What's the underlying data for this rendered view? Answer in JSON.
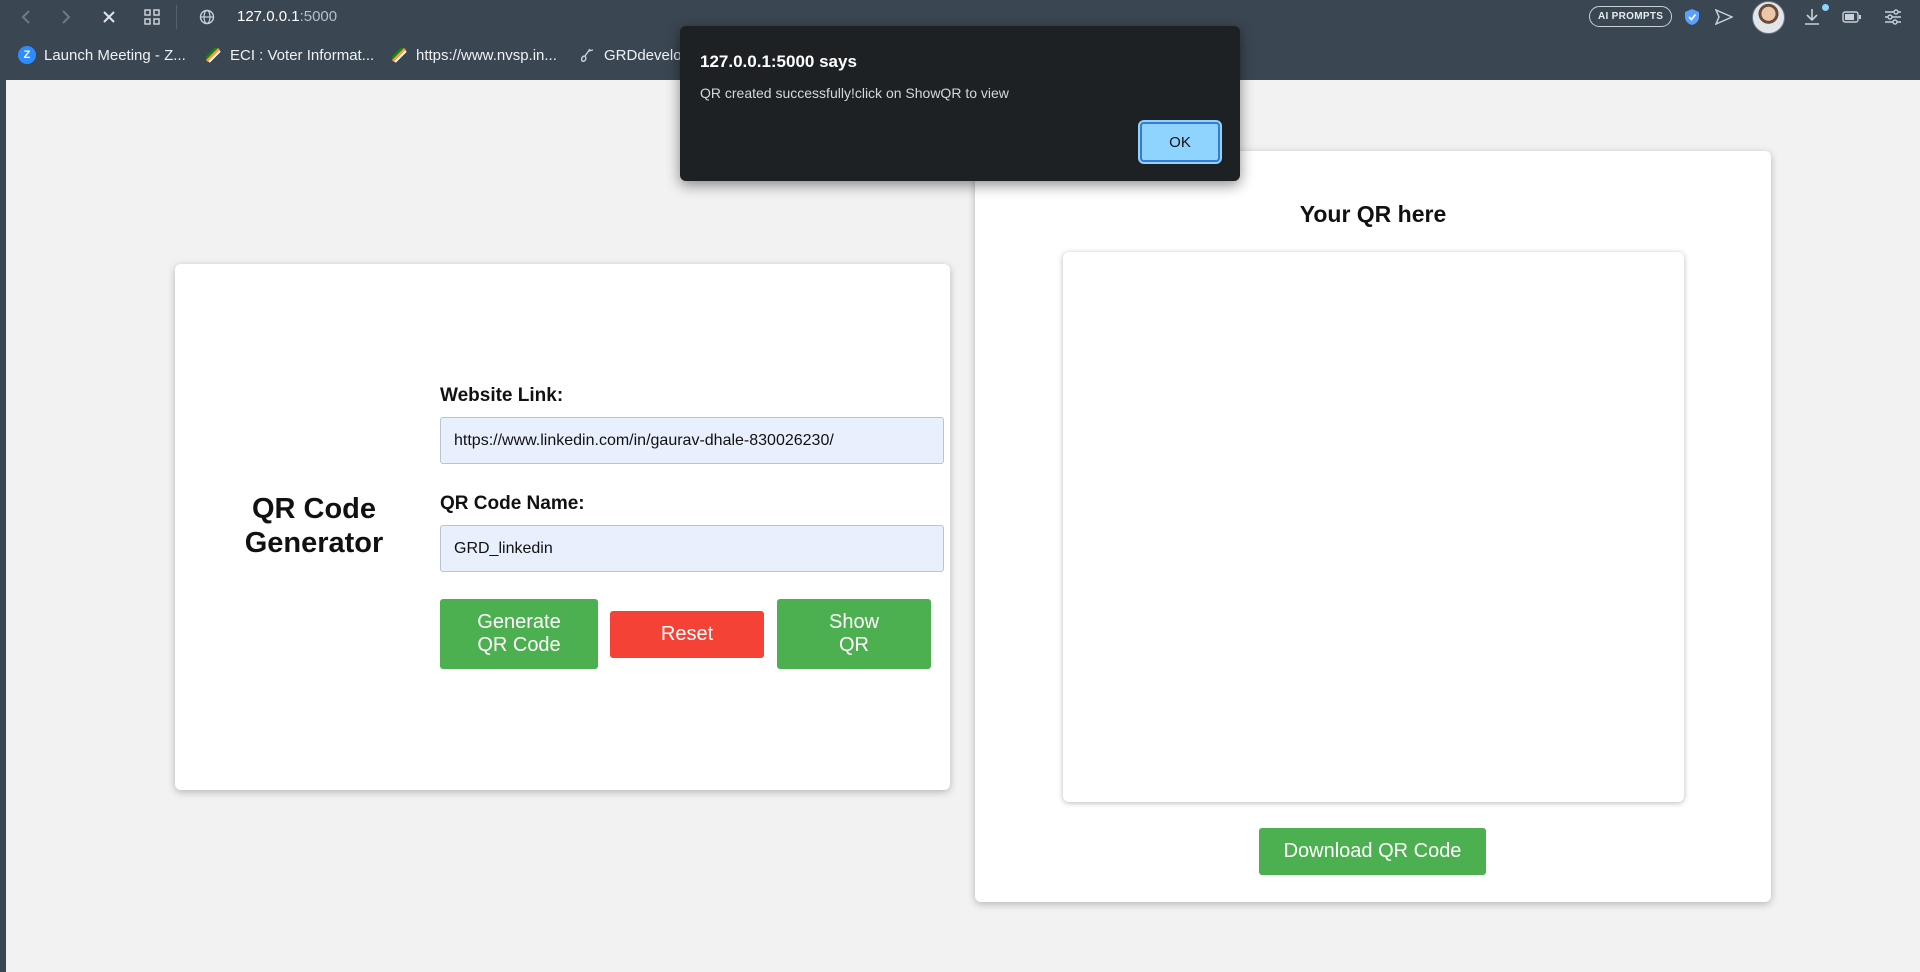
{
  "browser": {
    "url_host": "127.0.0.1",
    "url_port": ":5000",
    "ai_prompts_label": "AI PROMPTS",
    "bookmarks": [
      {
        "label": "Launch Meeting - Z...",
        "icon": "zoom-icon"
      },
      {
        "label": "ECI : Voter Informat...",
        "icon": "eci-icon"
      },
      {
        "label": "https://www.nvsp.in...",
        "icon": "nvsp-icon"
      },
      {
        "label": "GRDdevelo",
        "icon": "grd-icon"
      }
    ]
  },
  "app": {
    "title": "QR Code Generator",
    "website_link_label": "Website Link:",
    "website_link_value": "https://www.linkedin.com/in/gaurav-dhale-830026230/",
    "qr_name_label": "QR Code Name:",
    "qr_name_value": "GRD_linkedin",
    "generate_label": "Generate QR Code",
    "reset_label": "Reset",
    "show_label": "Show QR",
    "qr_heading": "Your QR here",
    "download_label": "Download QR Code"
  },
  "dialog": {
    "title": "127.0.0.1:5000 says",
    "message": "QR created successfully!click on ShowQR to view",
    "ok_label": "OK"
  },
  "colors": {
    "green": "#4caf50",
    "red": "#f44336",
    "input_bg": "#e8f0fd",
    "dialog_bg": "#1e2124",
    "ok_bg": "#8fd3ff"
  }
}
